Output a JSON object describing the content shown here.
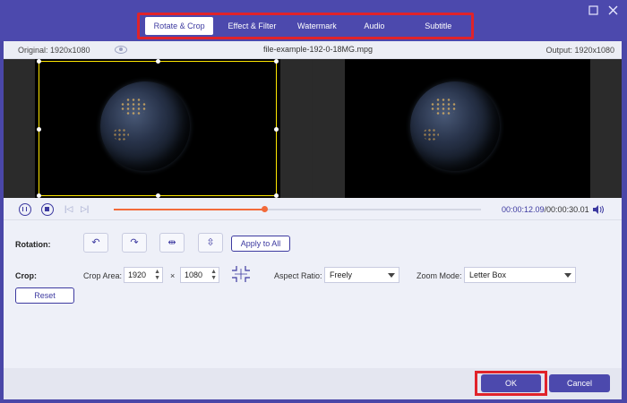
{
  "tabs": [
    {
      "label": "Rotate & Crop",
      "active": true
    },
    {
      "label": "Effect & Filter",
      "active": false
    },
    {
      "label": "Watermark",
      "active": false
    },
    {
      "label": "Audio",
      "active": false
    },
    {
      "label": "Subtitle",
      "active": false
    }
  ],
  "window": {
    "maximize_icon": "maximize-icon",
    "close_icon": "close-icon"
  },
  "info": {
    "original": "Original: 1920x1080",
    "filename": "file-example-192-0-18MG.mpg",
    "output": "Output: 1920x1080"
  },
  "playback": {
    "current_time": "00:00:12.09",
    "total_time": "/00:00:30.01",
    "progress": 0.41,
    "accent_color": "#f26a3a"
  },
  "rotation": {
    "label": "Rotation:",
    "buttons": [
      "rotate-left",
      "rotate-right",
      "flip-horizontal",
      "flip-vertical"
    ],
    "apply_all": "Apply to All"
  },
  "crop": {
    "label": "Crop:",
    "area_label": "Crop Area:",
    "width": "1920",
    "times": "×",
    "height": "1080",
    "aspect_label": "Aspect Ratio:",
    "aspect_value": "Freely",
    "zoom_label": "Zoom Mode:",
    "zoom_value": "Letter Box",
    "reset": "Reset"
  },
  "footer": {
    "ok": "OK",
    "cancel": "Cancel"
  },
  "colors": {
    "brand": "#4c49ad",
    "highlight": "#e0232a",
    "crop_frame": "#ffe800"
  }
}
